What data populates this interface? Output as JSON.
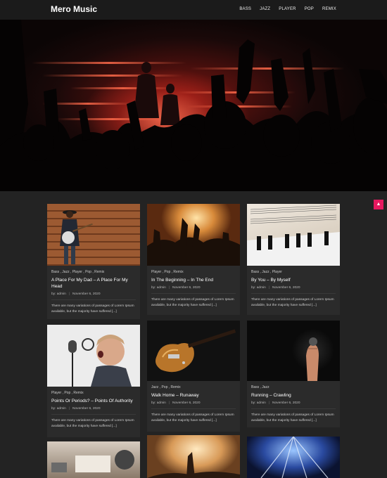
{
  "header": {
    "site_title": "Mero Music",
    "nav": [
      "BASS",
      "JAZZ",
      "PLAYER",
      "POP",
      "REMIX"
    ]
  },
  "scroll_top_icon": "arrow-up-icon",
  "posts": [
    {
      "categories": "Bass , Jazz , Player , Pop , Remix",
      "title": "A Place For My Dad – A Place For My Head",
      "author": "by: admin",
      "date": "November 6, 2020",
      "excerpt": "There are many variations of passages of Lorem Ipsum available, but the majority have suffered [...]"
    },
    {
      "categories": "Player , Pop , Remix",
      "title": "In The Beginning – In The End",
      "author": "by: admin",
      "date": "November 6, 2020",
      "excerpt": "There are many variations of passages of Lorem Ipsum available, but the majority have suffered [...]"
    },
    {
      "categories": "Bass , Jazz , Player",
      "title": "By You – By Myself",
      "author": "by: admin",
      "date": "November 6, 2020",
      "excerpt": "There are many variations of passages of Lorem Ipsum available, but the majority have suffered [...]"
    },
    {
      "categories": "Player , Pop , Remix",
      "title": "Points Or Periods? – Points Of Authority",
      "author": "by: admin",
      "date": "November 6, 2020",
      "excerpt": "There are many variations of passages of Lorem Ipsum available, but the majority have suffered [...]"
    },
    {
      "categories": "Jazz , Pop , Remix",
      "title": "Walk Home – Runaway",
      "author": "by: admin",
      "date": "November 6, 2020",
      "excerpt": "There are many variations of passages of Lorem Ipsum available, but the majority have suffered [...]"
    },
    {
      "categories": "Bass , Jazz",
      "title": "Running – Crawling",
      "author": "by: admin",
      "date": "November 6, 2020",
      "excerpt": "There are many variations of passages of Lorem Ipsum available, but the majority have suffered [...]"
    }
  ]
}
